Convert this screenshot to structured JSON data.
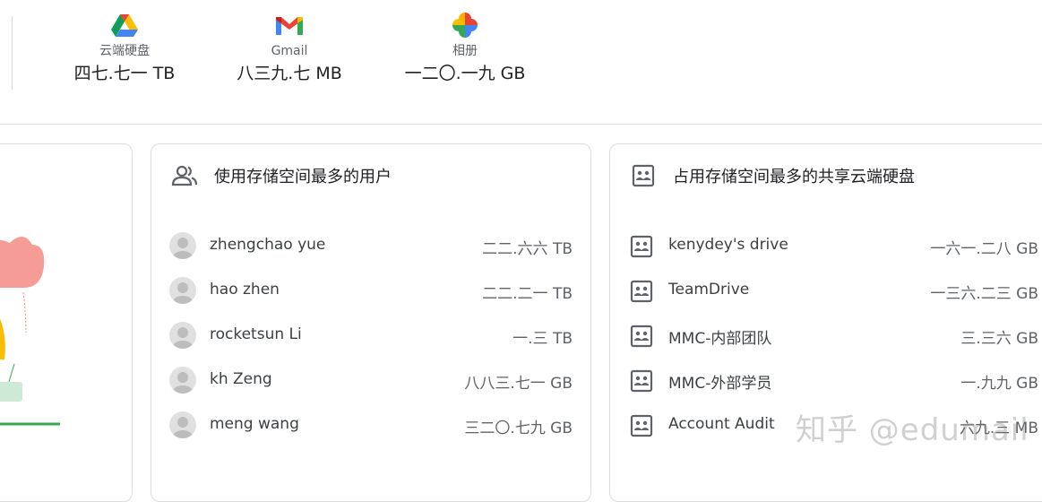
{
  "services": [
    {
      "name": "云端硬盘",
      "value": "四七.七一 TB",
      "icon": "google-drive-icon"
    },
    {
      "name": "Gmail",
      "value": "八三九.七 MB",
      "icon": "gmail-icon"
    },
    {
      "name": "相册",
      "value": "一二〇.一九 GB",
      "icon": "google-photos-icon"
    }
  ],
  "top_users": {
    "title": "使用存储空间最多的用户",
    "icon": "people-icon",
    "rows": [
      {
        "name": "zhengchao yue",
        "value": "二二.六六 TB"
      },
      {
        "name": "hao zhen",
        "value": "二二.二一 TB"
      },
      {
        "name": "rocketsun Li",
        "value": "一.三 TB"
      },
      {
        "name": "kh Zeng",
        "value": "八八三.七一 GB"
      },
      {
        "name": "meng wang",
        "value": "三二〇.七九 GB"
      }
    ]
  },
  "top_shared_drives": {
    "title": "占用存储空间最多的共享云端硬盘",
    "icon": "shared-drive-icon",
    "rows": [
      {
        "name": "kenydey's drive",
        "value": "一六一.二八 GB"
      },
      {
        "name": "TeamDrive",
        "value": "一三六.二三 GB"
      },
      {
        "name": "MMC-内部团队",
        "value": "三.三六 GB"
      },
      {
        "name": "MMC-外部学员",
        "value": "一.九九 GB"
      },
      {
        "name": "Account Audit",
        "value": "六九.三 MB"
      }
    ]
  },
  "watermark": "知乎 @edumail",
  "colors": {
    "text_primary": "#202124",
    "text_secondary": "#5f6368",
    "border": "#dadce0",
    "accent_green": "#34a853"
  }
}
